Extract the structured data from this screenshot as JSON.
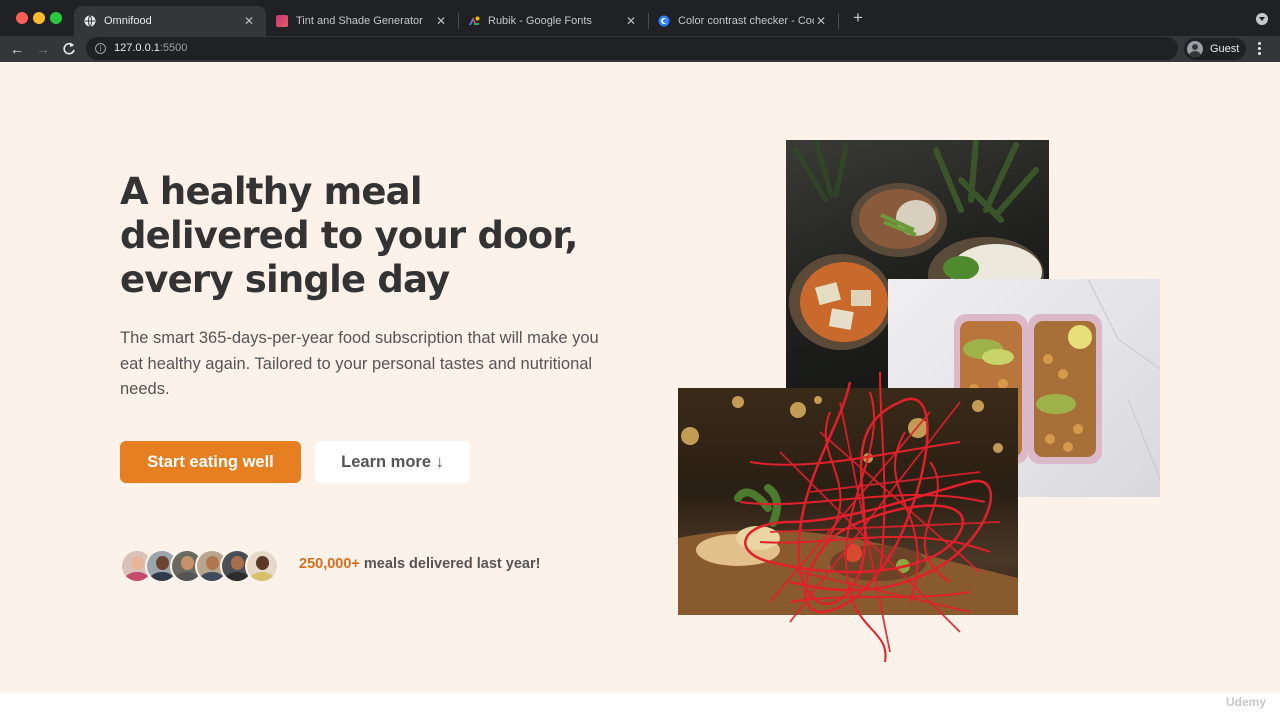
{
  "browser": {
    "tabs": [
      {
        "title": "Omnifood",
        "icon": "globe-icon",
        "active": true
      },
      {
        "title": "Tint and Shade Generator",
        "icon": "tint-shade-favicon-icon",
        "active": false
      },
      {
        "title": "Rubik - Google Fonts",
        "icon": "google-fonts-favicon-icon",
        "active": false
      },
      {
        "title": "Color contrast checker - Coolo",
        "icon": "coolors-favicon-icon",
        "active": false
      }
    ],
    "url_host": "127.0.0.1",
    "url_port": ":5500",
    "profile_name": "Guest"
  },
  "hero": {
    "heading": "A healthy meal delivered to your door, every single day",
    "description": "The smart 365-days-per-year food subscription that will make you eat healthy again. Tailored to your personal tastes and nutritional needs.",
    "primary_button": "Start eating well",
    "secondary_button": "Learn more ↓",
    "delivered_count": "250,000+",
    "delivered_text": " meals delivered last year!"
  },
  "watermark": "Udemy",
  "colors": {
    "accent": "#e67e22",
    "accent_dark": "#cf711f",
    "hero_bg": "#fdf2e9",
    "heading": "#333333",
    "body_text": "#555555",
    "scribble": "#e0202a"
  }
}
